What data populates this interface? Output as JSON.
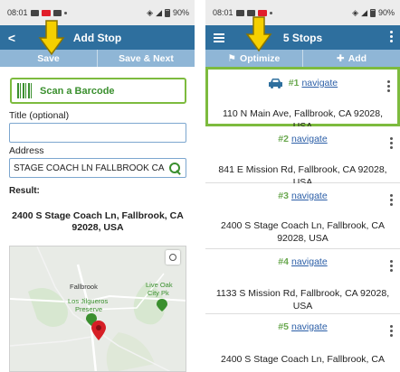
{
  "left": {
    "status": {
      "time": "08:01",
      "battery": "90%"
    },
    "header": {
      "back_glyph": "<",
      "title": "Add Stop"
    },
    "actions": {
      "save": "Save",
      "save_next": "Save & Next"
    },
    "scan": {
      "label": "Scan a Barcode"
    },
    "title_field": {
      "label": "Title (optional)",
      "value": ""
    },
    "address_field": {
      "label": "Address",
      "value": "STAGE COACH LN FALLBROOK CA"
    },
    "result": {
      "label": "Result:",
      "address_line1": "2400 S Stage Coach Ln, Fallbrook, CA",
      "address_line2": "92028, USA"
    },
    "map": {
      "labels": {
        "fallbrook": "Fallbrook",
        "preserve_1": "Los Jilgueros",
        "preserve_2": "Preserve",
        "park_1": "Live Oak",
        "park_2": "City Pk"
      }
    }
  },
  "right": {
    "status": {
      "time": "08:01",
      "battery": "90%"
    },
    "header": {
      "title": "5 Stops"
    },
    "actions": {
      "optimize": "Optimize",
      "add": "Add"
    },
    "stops": [
      {
        "number": "#1",
        "link": "navigate",
        "address": "110 N Main Ave, Fallbrook, CA 92028, USA"
      },
      {
        "number": "#2",
        "link": "navigate",
        "address": "841 E Mission Rd, Fallbrook, CA 92028, USA"
      },
      {
        "number": "#3",
        "link": "navigate",
        "address_line1": "2400 S Stage Coach Ln, Fallbrook, CA",
        "address_line2": "92028, USA"
      },
      {
        "number": "#4",
        "link": "navigate",
        "address_line1": "1133 S Mission Rd, Fallbrook, CA 92028,",
        "address_line2": "USA"
      },
      {
        "number": "#5",
        "link": "navigate",
        "address_line1": "2400 S Stage Coach Ln, Fallbrook, CA"
      }
    ]
  },
  "colors": {
    "header": "#2e6f9e",
    "action_bar": "#8fb6d6",
    "accent_green": "#7dbb3e",
    "link": "#2b5ea7",
    "arrow_yellow": "#f5d000"
  }
}
